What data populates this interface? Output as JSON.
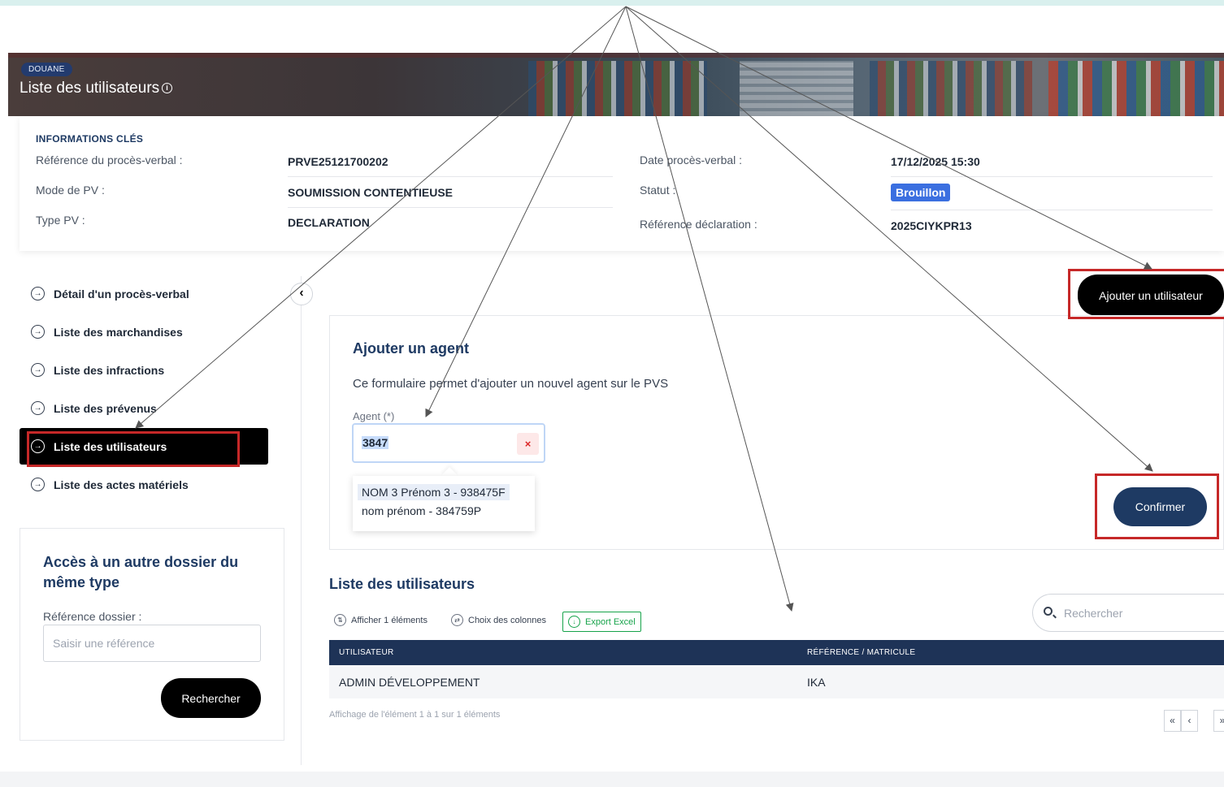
{
  "header": {
    "tag": "DOUANE",
    "title": "Liste des utilisateurs",
    "info_icon": "i"
  },
  "info": {
    "heading": "INFORMATIONS CLÉS",
    "left": [
      {
        "label": "Référence du procès-verbal :",
        "value": "PRVE25121700202"
      },
      {
        "label": "Mode de PV :",
        "value": "SOUMISSION CONTENTIEUSE"
      },
      {
        "label": "Type PV :",
        "value": "DECLARATION"
      }
    ],
    "right": [
      {
        "label": "Date procès-verbal :",
        "value": "17/12/2025 15:30"
      },
      {
        "label": "Statut :",
        "value": "Brouillon"
      },
      {
        "label": "Référence déclaration :",
        "value": "2025CIYKPR13"
      }
    ],
    "status_color": "#3b6fe0"
  },
  "sidebar": {
    "items": [
      {
        "label": "Détail d'un procès-verbal",
        "active": false
      },
      {
        "label": "Liste des marchandises",
        "active": false
      },
      {
        "label": "Liste des infractions",
        "active": false
      },
      {
        "label": "Liste des prévenus",
        "active": false
      },
      {
        "label": "Liste des utilisateurs",
        "active": true
      },
      {
        "label": "Liste des actes matériels",
        "active": false
      }
    ],
    "icon": "arrow-circle-right-icon",
    "collapse_glyph": "‹"
  },
  "access": {
    "title": "Accès à un autre dossier du même type",
    "label": "Référence dossier :",
    "placeholder": "Saisir une référence",
    "button": "Rechercher"
  },
  "form": {
    "add_button": "Ajouter un utilisateur",
    "title": "Ajouter un agent",
    "description": "Ce formulaire permet d'ajouter un nouvel agent sur le PVS",
    "agent_label": "Agent (*)",
    "agent_value": "3847",
    "clear_glyph": "×",
    "options": [
      "NOM 3 Prénom 3 - 938475F",
      "nom prénom - 384759P"
    ],
    "confirm_button": "Confirmer"
  },
  "users": {
    "title": "Liste des utilisateurs",
    "toolbar": {
      "show": "Afficher 1 éléments",
      "columns": "Choix des colonnes",
      "export": "Export Excel"
    },
    "search_placeholder": "Rechercher",
    "columns": [
      "UTILISATEUR",
      "RÉFÉRENCE / MATRICULE"
    ],
    "rows": [
      [
        "ADMIN DÉVELOPPEMENT",
        "IKA"
      ]
    ],
    "footer": "Affichage de l'élément 1 à 1 sur 1 éléments",
    "pager": [
      "«",
      "‹",
      "»"
    ]
  },
  "colors": {
    "primary": "#1e3a63",
    "table_header": "#1e3357",
    "annotation": "#c62828",
    "accent_green": "#16a34a"
  }
}
